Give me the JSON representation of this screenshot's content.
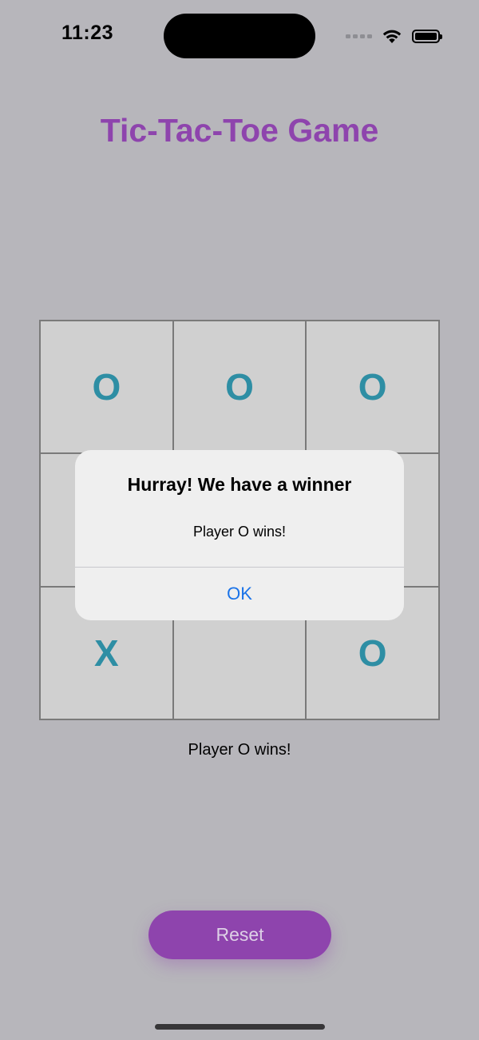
{
  "status_bar": {
    "time": "11:23",
    "icons": [
      "signal-icon",
      "wifi-icon",
      "battery-icon"
    ]
  },
  "header": {
    "title": "Tic-Tac-Toe Game",
    "title_color": "#8e44ad"
  },
  "board": {
    "cells": [
      "O",
      "O",
      "O",
      "",
      "",
      "",
      "X",
      "",
      "O"
    ],
    "mark_color": "#2e8ea4"
  },
  "status": {
    "text": "Player O wins!"
  },
  "controls": {
    "reset_label": "Reset",
    "button_color": "#8e44ad"
  },
  "alert": {
    "title": "Hurray! We have a winner",
    "message": "Player O wins!",
    "ok_label": "OK",
    "ok_color": "#1a73e8"
  }
}
